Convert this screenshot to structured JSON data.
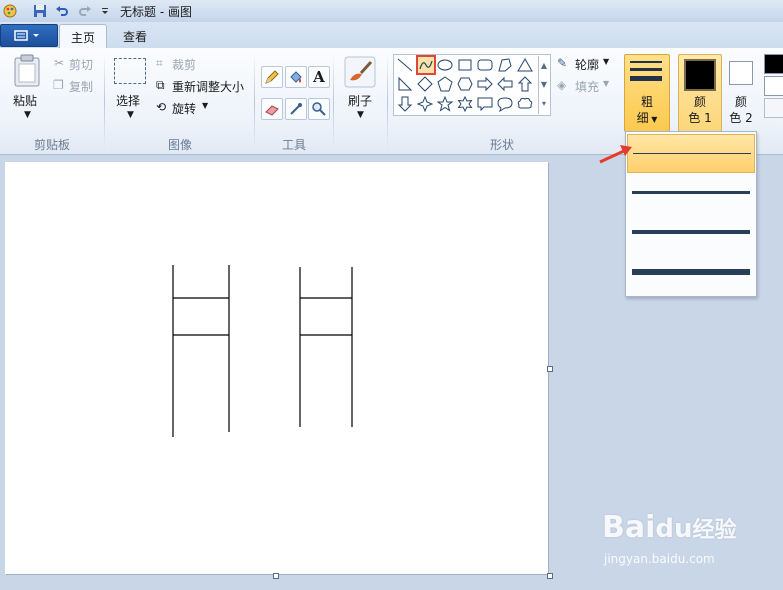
{
  "window": {
    "title": "无标题 - 画图"
  },
  "tabs": {
    "home": "主页",
    "view": "查看"
  },
  "clipboard": {
    "paste": "粘贴",
    "cut": "剪切",
    "copy": "复制",
    "group": "剪贴板"
  },
  "image": {
    "select": "选择",
    "crop": "裁剪",
    "resize": "重新调整大小",
    "rotate": "旋转",
    "group": "图像"
  },
  "tools": {
    "group": "工具",
    "text_glyph": "A"
  },
  "brushes": {
    "label": "刷子"
  },
  "shapes": {
    "group": "形状",
    "outline": "轮廓",
    "fill": "填充"
  },
  "size": {
    "label_line1": "粗",
    "label_line2": "细",
    "options": [
      "1px",
      "3px",
      "5px",
      "8px"
    ],
    "selected_index": 0
  },
  "colors": {
    "color1_line1": "颜",
    "color1_line2": "色 1",
    "color2_line1": "颜",
    "color2_line2": "色 2",
    "color1_value": "#000000",
    "color2_value": "#ffffff",
    "accent_selected": "#fbd06a",
    "highlight_border": "#e0463a"
  },
  "watermark": {
    "main": "Bai",
    "paw": "du",
    "brand": "经验",
    "url": "jingyan.baidu.com"
  }
}
